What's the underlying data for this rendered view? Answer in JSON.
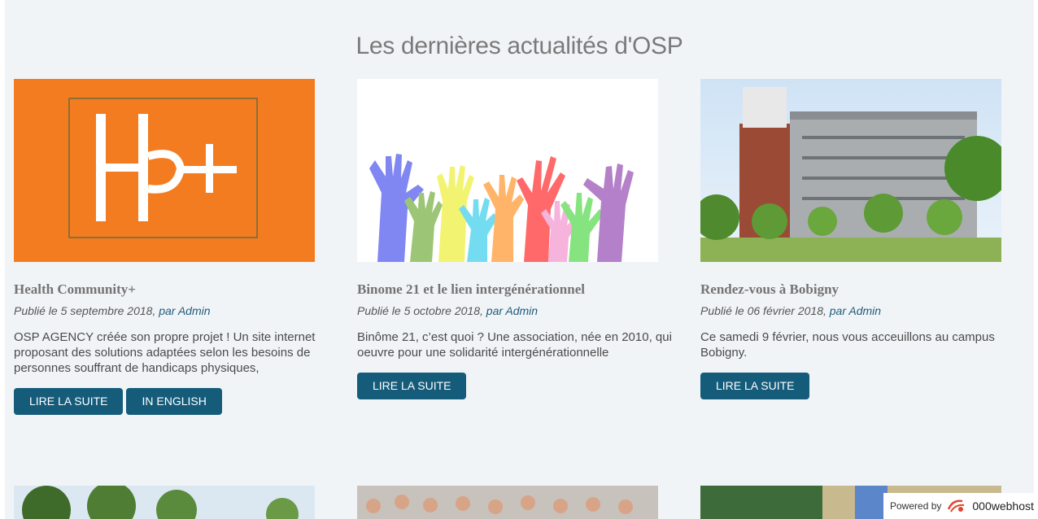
{
  "section": {
    "title": "Les dernières actualités d'OSP"
  },
  "posts": [
    {
      "title": "Health Community+",
      "meta_prefix": "Publié le 5 septembre 2018, ",
      "author": "par Admin",
      "excerpt": "OSP AGENCY créée son propre projet ! Un site internet proposant des solutions adaptées selon les besoins de personnes souffrant de handicaps physiques,",
      "read_more": "LIRE LA SUITE",
      "in_english": "IN ENGLISH",
      "image_colors": {
        "bg": "#f47c20",
        "logo": "#ffffff"
      }
    },
    {
      "title": "Binome 21 et le lien intergénérationnel",
      "meta_prefix": "Publié le 5 octobre 2018, ",
      "author": "par Admin",
      "excerpt": "Binôme 21, c’est quoi ? Une association, née en 2010, qui oeuvre pour une solidarité intergénérationnelle",
      "read_more": "LIRE LA SUITE"
    },
    {
      "title": "Rendez-vous à Bobigny",
      "meta_prefix": "Publié le 06 février 2018, ",
      "author": "par Admin",
      "excerpt": "Ce samedi 9 février, nous vous acceuillons au campus Bobigny.",
      "read_more": "LIRE LA SUITE"
    }
  ],
  "footer_badge": {
    "powered": "Powered by",
    "brand": "000webhost"
  },
  "colors": {
    "accent": "#155c7a",
    "title": "#7a7a7a",
    "background": "#f1f4f7"
  }
}
